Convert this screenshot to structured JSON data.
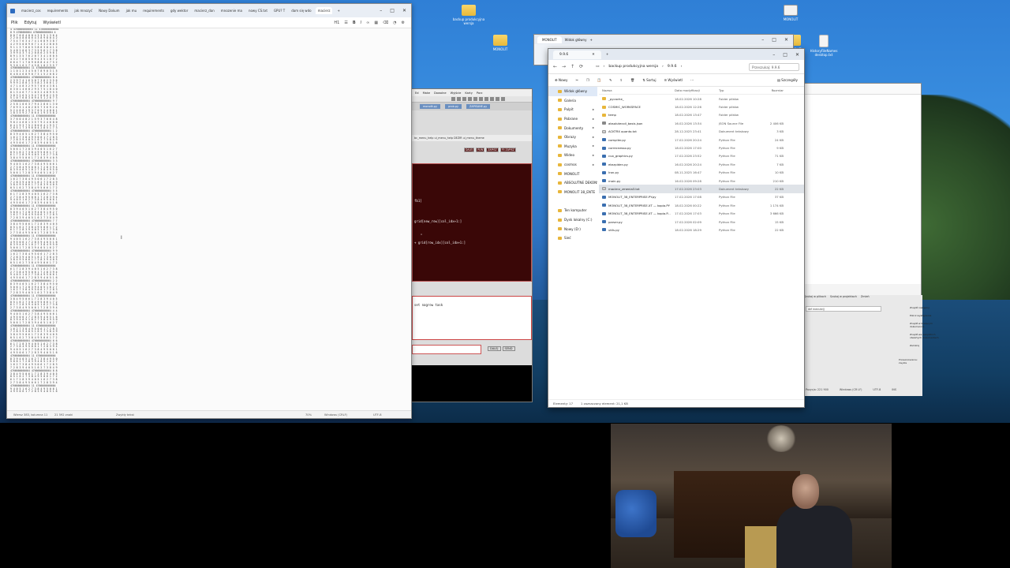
{
  "notepad": {
    "tabs": [
      "macierz_cos",
      "requirements",
      "jak mnozyć",
      "Nowy Dokum",
      "jak mu",
      "requirements",
      "gdy wektor",
      "macierz_dan",
      "mnozenie ma",
      "nowy CS.txt",
      "GPU? T",
      "dam się wdo",
      "macierz"
    ],
    "menu": [
      "Plik",
      "Edytuj",
      "Wyświetl"
    ],
    "heading_tool": "H1",
    "status": {
      "position": "Wiersz 383, kolumna 11",
      "chars": "21 592 znaki",
      "format": "Zwykły tekst",
      "zoom": "70%",
      "line_ending": "Windows (CRLF)",
      "encoding": "UTF-8"
    },
    "lines": [
      "4 4766666666664 11 4766666666664",
      "8 9 4766666664 4766666666664 4",
      "8 8 7 0 8 4 0 8 4 3 5 9 1 3 6 4",
      "2 2 0 4 8 8 8 6 4 3 8 9 8 0 4 2",
      "7 5 4 7 6 3 4 7 4 1 0 8 9 3 8 7",
      "4 2 9 5 0 8 9 6 7 1 4 3 2 8 0 5",
      "9 1 1 3 7 0 6 5 3 8 6 3 0 4 1 2",
      "5 4 8 2 0 6 3 7 3 5 9 6 1 7 3 8",
      "3 9 9 4 3 7 4 2 0 8 6 2 5 9 6 1",
      "8 9 1 3 5 7 6 2 0 7 3 4 1 6 0 5",
      "4 3 2 7 6 0 5 6 9 4 3 5 1 8 7 2",
      "6 6 4 7 1 7 0 9 6 8 8 4 4 7 5 2",
      "9 3 6 1 6 2 7 4 5 8 1 0 2 3 5 7",
      "4766666666664 11 4766666666664",
      "1 1 0 1 2 3 4 5 6 7 8 9 0 3 1 5",
      "6 4 8 4 6 8 9 0 7 3 1 5 2 0 8 2",
      "4766666666664 4766666666664 8 4",
      "2 3 9 7 4 1 6 5 0 7 3 8 2 3 5 6",
      "9 9 9 2 8 0 1 3 5 8 2 3 6 6 1 2",
      "4 7 1 4 8 3 2 9 5 7 0 6 4 3 8 1",
      "6 3 0 1 4 6 0 2 9 3 7 5 1 8 4 0",
      "8 1 3 4 6 7 7 1 0 3 2 4 8 9 5 3",
      "3 8 3 2 6 5 1 9 4 7 0 8 6 2 5 9",
      "5 1 0 7 6 8 3 0 9 4 5 1 2 6 7 3",
      "4766666666664 4766666666664 9 7",
      "2 5 8 1 0 6 3 7 9 4 2 8 6 1 3 0",
      "7 6 9 3 1 4 0 2 8 5 7 3 6 9 2 4",
      "5 2 4 6 8 1 9 3 7 0 5 2 4 8 6 1",
      "1 8 3 5 9 2 7 0 6 4 1 9 3 5 8 2",
      "4766666666664 11 4766666666664",
      "3 7 6 0 4 8 2 1 5 9 3 7 0 6 4 8",
      "9 0 2 4 6 8 1 3 5 7 9 2 4 6 8 0",
      "6 4 1 9 3 7 5 2 8 0 6 4 1 9 3 7",
      "2 8 5 1 7 3 9 6 0 4 2 8 5 1 7 3",
      "4766666666664 4766666666664 1 2",
      "8 3 9 4 0 5 1 6 2 7 3 8 4 9 5 0",
      "1 6 2 7 3 8 4 9 5 0 6 1 7 2 8 3",
      "7 2 8 3 9 4 0 5 1 6 2 7 3 8 4 9",
      "4 9 5 0 6 1 7 2 8 3 9 4 0 5 1 6",
      "4766666666664 11 4766666666664",
      "5 0 6 1 7 2 8 3 9 4 0 5 1 6 2 7",
      "0 5 1 6 2 7 3 8 4 9 5 0 6 1 7 2",
      "6 1 7 2 8 3 9 4 0 5 1 6 2 7 3 8",
      "3 8 4 9 5 0 6 1 7 2 8 3 9 4 0 5",
      "4766666666664 4766666666664 3 3",
      "9 4 0 5 1 6 2 7 3 8 4 9 5 0 6 1",
      "2 7 3 8 4 9 5 0 6 1 7 2 8 3 9 4",
      "8 3 9 4 0 5 1 6 2 7 3 8 4 9 5 0",
      "5 0 6 1 7 2 8 3 9 4 0 5 1 6 2 7",
      "4766666666664 11 4766666666664",
      "1 6 2 7 3 8 4 9 5 0 6 1 7 2 8 3",
      "7 2 8 3 9 4 0 5 1 6 2 7 3 8 4 9",
      "3 8 4 9 5 0 6 1 7 2 8 3 9 4 0 5",
      "0 5 1 6 2 7 3 8 4 9 5 0 6 1 7 2",
      "4766666666664 4766666666664 5 5",
      "6 1 7 2 8 3 9 4 0 5 1 6 2 7 3 8",
      "2 7 3 8 4 9 5 0 6 1 7 2 8 3 9 4",
      "9 4 0 5 1 6 2 7 3 8 4 9 5 0 6 1",
      "4 9 5 0 6 1 7 2 8 3 9 4 0 5 1 6",
      "4766666666664 11 4766666666664",
      "8 3 9 4 0 5 1 6 2 7 3 8 4 9 5 0",
      "5 0 6 1 7 2 8 3 9 4 0 5 1 6 2 7",
      "1 6 2 7 3 8 4 9 5 0 6 1 7 2 8 3",
      "7 2 8 3 9 4 0 5 1 6 2 7 3 8 4 9",
      "4766666666664 4766666666664 7 7",
      "3 8 4 9 5 0 6 1 7 2 8 3 9 4 0 5",
      "0 5 1 6 2 7 3 8 4 9 5 0 6 1 7 2",
      "6 1 7 2 8 3 9 4 0 5 1 6 2 7 3 8",
      "2 7 3 8 4 9 5 0 6 1 7 2 8 3 9 4",
      "4766666666664 11 4766666666664",
      "9 4 0 5 1 6 2 7 3 8 4 9 5 0 6 1",
      "4 9 5 0 6 1 7 2 8 3 9 4 0 5 1 6",
      "8 3 9 4 0 5 1 6 2 7 3 8 4 9 5 0",
      "5 0 6 1 7 2 8 3 9 4 0 5 1 6 2 7",
      "4766666666664 4766666666664 9 9",
      "1 6 2 7 3 8 4 9 5 0 6 1 7 2 8 3",
      "7 2 8 3 9 4 0 5 1 6 2 7 3 8 4 9",
      "3 8 4 9 5 0 6 1 7 2 8 3 9 4 0 5",
      "0 5 1 6 2 7 3 8 4 9 5 0 6 1 7 2",
      "4766666666664 11 4766666666664",
      "6 1 7 2 8 3 9 4 0 5 1 6 2 7 3 8",
      "2 7 3 8 4 9 5 0 6 1 7 2 8 3 9 4",
      "9 4 0 5 1 6 2 7 3 8 4 9 5 0 6 1",
      "4 9 5 0 6 1 7 2 8 3 9 4 0 5 1 6",
      "4766666666664 4766666666664 2 2",
      "8 3 9 4 0 5 1 6 2 7 3 8 4 9 5 0",
      "5 0 6 1 7 2 8 3 9 4 0 5 1 6 2 7",
      "1 6 2 7 3 8 4 9 5 0 6 1 7 2 8 3",
      "7 2 8 3 9 4 0 5 1 6 2 7 3 8 4 9",
      "4766666666664 11 4766666666664",
      "3 8 4 9 5 0 6 1 7 2 8 3 9 4 0 5",
      "0 5 1 6 2 7 3 8 4 9 5 0 6 1 7 2",
      "6 1 7 2 8 3 9 4 0 5 1 6 2 7 3 8",
      "2 7 3 8 4 9 5 0 6 1 7 2 8 3 9 4",
      "4766666666664 4766666666664 4 4",
      "9 4 0 5 1 6 2 7 3 8 4 9 5 0 6 1",
      "4 9 5 0 6 1 7 2 8 3 9 4 0 5 1 6",
      "8 3 9 4 0 5 1 6 2 7 3 8 4 9 5 0",
      "5 0 6 1 7 2 8 3 9 4 0 5 1 6 2 7",
      "4766666666664 11 4766666666664",
      "1 6 2 7 3 8 4 9 5 0 6 1 7 2 8 3",
      "7 2 8 3 9 4 0 5 1 6 2 7 3 8 4 9",
      "3 8 4 9 5 0 6 1 7 2 8 3 9 4 0 5",
      "0 5 1 6 2 7 3 8 4 9 5 0 6 1 7 2",
      "4766666666664 4766666666664 6 6",
      "6 1 7 2 8 3 9 4 0 5 1 6 2 7 3 8",
      "2 7 3 8 4 9 5 0 6 1 7 2 8 3 9 4",
      "9 4 0 5 1 6 2 7 3 8 4 9 5 0 6 1",
      "4 9 5 0 6 1 7 2 8 3 9 4 0 5 1 6",
      "4766666666664 11 4766666666664",
      "8 3 9 4 0 5 1 6 2 7 3 8 4 9 5 0",
      "5 0 6 1 7 2 8 3 9 4 0 5 1 6 2 7",
      "1 6 2 7 3 8 4 9 5 0 6 1 7 2 8 3",
      "7 2 8 3 9 4 0 5 1 6 2 7 3 8 4 9",
      "4766666666664 4766666666664 8 8",
      "3 8 4 9 5 0 6 1 7 2 8 3 9 4 0 5",
      "0 5 1 6 2 7 3 8 4 9 5 0 6 1 7 2",
      "6 1 7 2 8 3 9 4 0 5 1 6 2 7 3 8",
      "2 7 3 8 4 9 5 0 6 1 7 2 8 3 9 4",
      "4766666666664 11 4766666666664",
      "9 4 0 5 1 6 2 7 3 8 4 9 5 0 6 1",
      "4 9 5 0 6 1 7 2 8 3 9 4 0 5 1 6"
    ]
  },
  "desktop_icons": [
    {
      "label": "backup produkcyjna wersja",
      "kind": "folder"
    },
    {
      "label": "MONOLIT",
      "kind": "folder"
    },
    {
      "label": "MONOLIT",
      "kind": "folder"
    },
    {
      "label": "HistoryFileNames desktop.txt",
      "kind": "doc"
    },
    {
      "label": "MONOLIT",
      "kind": "app"
    }
  ],
  "explorer_back": {
    "tabs": [
      "MONOLIT",
      "Widok główny"
    ]
  },
  "ide": {
    "menu": [
      "Ed",
      "Make",
      "Dowolne",
      "Wyjście",
      "Karty",
      "Porz"
    ],
    "files": [
      "monolit.py",
      "prob.py",
      "ZAPISANE.py"
    ],
    "path": "bc_menu_help   ui_menu_help   DEZIR   ui_menu_theme",
    "red_buttons": [
      "DALEJ",
      "RUN",
      "ZAPISZ",
      "F5 ZAPISZ"
    ],
    "code": [
      "fb1]",
      "grid[new_row][col_idx+1:]",
      "\"",
      "+ grid[row_idx][col_idx+1:]"
    ],
    "console": "set nagrow task",
    "input_buttons": [
      "DALEJ",
      "SEND"
    ]
  },
  "explorer": {
    "tab_title": "9.9.6",
    "breadcrumb": [
      "backup produkcyjna wersja",
      "9.9.6"
    ],
    "search_placeholder": "Przeszukaj: 9.9.6",
    "cmd": [
      "Nowy",
      "Sortuj",
      "Wyświetl",
      "Szczegóły"
    ],
    "sidebar": [
      {
        "label": "Widok główny",
        "selected": true
      },
      {
        "label": "Galeria"
      },
      {
        "label": "Pulpit"
      },
      {
        "label": "Pobrane"
      },
      {
        "label": "Dokumenty"
      },
      {
        "label": "Obrazy"
      },
      {
        "label": "Muzyka"
      },
      {
        "label": "Wideo"
      },
      {
        "label": "cosmos"
      },
      {
        "label": "MONOLIT"
      },
      {
        "label": "ABSOLUTNE DEKONST"
      },
      {
        "label": "MONOLIT 38_ENTE"
      },
      {
        "label": "Ten komputer"
      },
      {
        "label": "Dysk lokalny (C:)"
      },
      {
        "label": "Nowy (D:)"
      },
      {
        "label": "Sieć"
      }
    ],
    "columns": [
      "Nazwa",
      "Data modyfikacji",
      "Typ",
      "Rozmiar"
    ],
    "rows": [
      {
        "name": "_pycache_",
        "date": "18.02.2026 10:28",
        "type": "Folder plików",
        "size": "",
        "kind": "folder"
      },
      {
        "name": "COSMIC_WORKSPACE",
        "date": "18.02.2026 12:26",
        "type": "Folder plików",
        "size": "",
        "kind": "folder"
      },
      {
        "name": "temp",
        "date": "18.02.2026 13:47",
        "type": "Folder plików",
        "size": "",
        "kind": "folder"
      },
      {
        "name": "absolutecoil_basis.json",
        "date": "16.02.2026 13:34",
        "type": "JSON Source File",
        "size": "2 406 KB",
        "kind": "json"
      },
      {
        "name": "ACKTRX quanto.txt",
        "date": "28.12.2025 23:41",
        "type": "Dokument tekstowy",
        "size": "3 KB",
        "kind": "txt"
      },
      {
        "name": "compiler.py",
        "date": "17.02.2026 20:24",
        "type": "Python File",
        "size": "24 KB",
        "kind": "py"
      },
      {
        "name": "correcnesso.py",
        "date": "18.02.2026 17:00",
        "type": "Python File",
        "size": "9 KB",
        "kind": "py"
      },
      {
        "name": "cuo_graphics.py",
        "date": "17.02.2026 23:52",
        "type": "Python File",
        "size": "71 KB",
        "kind": "py"
      },
      {
        "name": "ebsrpiden.py",
        "date": "16.02.2026 20:24",
        "type": "Python File",
        "size": "7 KB",
        "kind": "py"
      },
      {
        "name": "Iron.py",
        "date": "08.11.2025 16:47",
        "type": "Python File",
        "size": "10 KB",
        "kind": "py"
      },
      {
        "name": "main.py",
        "date": "16.02.2026 09:28",
        "type": "Python File",
        "size": "210 KB",
        "kind": "py"
      },
      {
        "name": "macierz_zmenia3.txt",
        "date": "17.02.2026 23:03",
        "type": "Dokument tekstowy",
        "size": "22 KB",
        "kind": "txt",
        "selected": true
      },
      {
        "name": "MONOLIT_38_ENTERPRISE.PY.py",
        "date": "17.02.2026 17:08",
        "type": "Python File",
        "size": "37 KB",
        "kind": "py"
      },
      {
        "name": "MONOLIT_38_ENTERPRISE.XT — kopia.PY",
        "date": "18.02.2026 00:22",
        "type": "Python File",
        "size": "1 174 KB",
        "kind": "py"
      },
      {
        "name": "MONOLIT_38_ENTERPRISE.XT — kopia.P...",
        "date": "17.02.2026 17:03",
        "type": "Python File",
        "size": "3 666 KB",
        "kind": "py"
      },
      {
        "name": "parser.py",
        "date": "17.02.2026 02:09",
        "type": "Python File",
        "size": "15 KB",
        "kind": "py"
      },
      {
        "name": "utils.py",
        "date": "18.02.2026 18:29",
        "type": "Python File",
        "size": "22 KB",
        "kind": "py"
      }
    ],
    "status_items": "Elementy: 17",
    "status_selected": "1 zaznaczony element: 21,1 KB"
  },
  "settings": {
    "tabs": [
      "Szukaj w plikach",
      "Szukaj w projektach",
      "Zmień"
    ],
    "dropdown": "def execute()",
    "buttons": [
      "Znajdź następny",
      "Policz wystąpienia",
      "Znajdź w bieżącym dokumencie",
      "Znajdź we wszystkich otwartych dokumentach",
      "Zamknij"
    ],
    "search_mode": "Przeszukiwanie: zwykłe",
    "status": [
      "Pozycja: 221 900",
      "Windows (CR LF)",
      "UTF-8",
      "INS"
    ]
  }
}
